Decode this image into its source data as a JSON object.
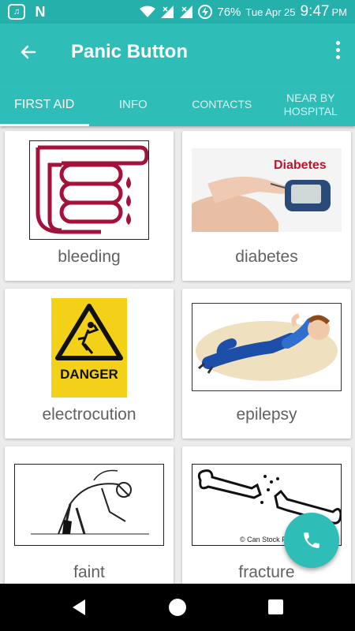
{
  "status_bar": {
    "battery": "76%",
    "date": "Tue Apr 25",
    "time": "9:47",
    "ampm": "PM",
    "icons": [
      "saavn-icon",
      "n-app-icon",
      "wifi-icon",
      "signal-icon",
      "signal-icon",
      "battery-charging-icon"
    ]
  },
  "app_bar": {
    "title": "Panic Button",
    "back_icon": "arrow-left-icon",
    "menu_icon": "more-vert-icon"
  },
  "tabs": [
    {
      "label": "FIRST AID",
      "active": true
    },
    {
      "label": "INFO",
      "active": false
    },
    {
      "label": "CONTACTS",
      "active": false
    },
    {
      "label": "NEAR BY HOSPITAL",
      "active": false
    }
  ],
  "cards": [
    {
      "label": "bleeding",
      "image": "bleeding-hand-illustration"
    },
    {
      "label": "diabetes",
      "image": "glucose-meter-photo",
      "image_text": "Diabetes"
    },
    {
      "label": "electrocution",
      "image": "danger-sign",
      "image_text": "DANGER"
    },
    {
      "label": "epilepsy",
      "image": "seizure-person-illustration"
    },
    {
      "label": "faint",
      "image": "fainting-person-sketch"
    },
    {
      "label": "fracture",
      "image": "broken-bone-illustration",
      "image_text": "© Can Stock Ph"
    }
  ],
  "fab": {
    "icon": "phone-icon"
  },
  "colors": {
    "primary": "#2ebdb7",
    "status_bar": "#25b0ac",
    "blood": "#a3123b",
    "danger_yellow": "#f3d118"
  }
}
